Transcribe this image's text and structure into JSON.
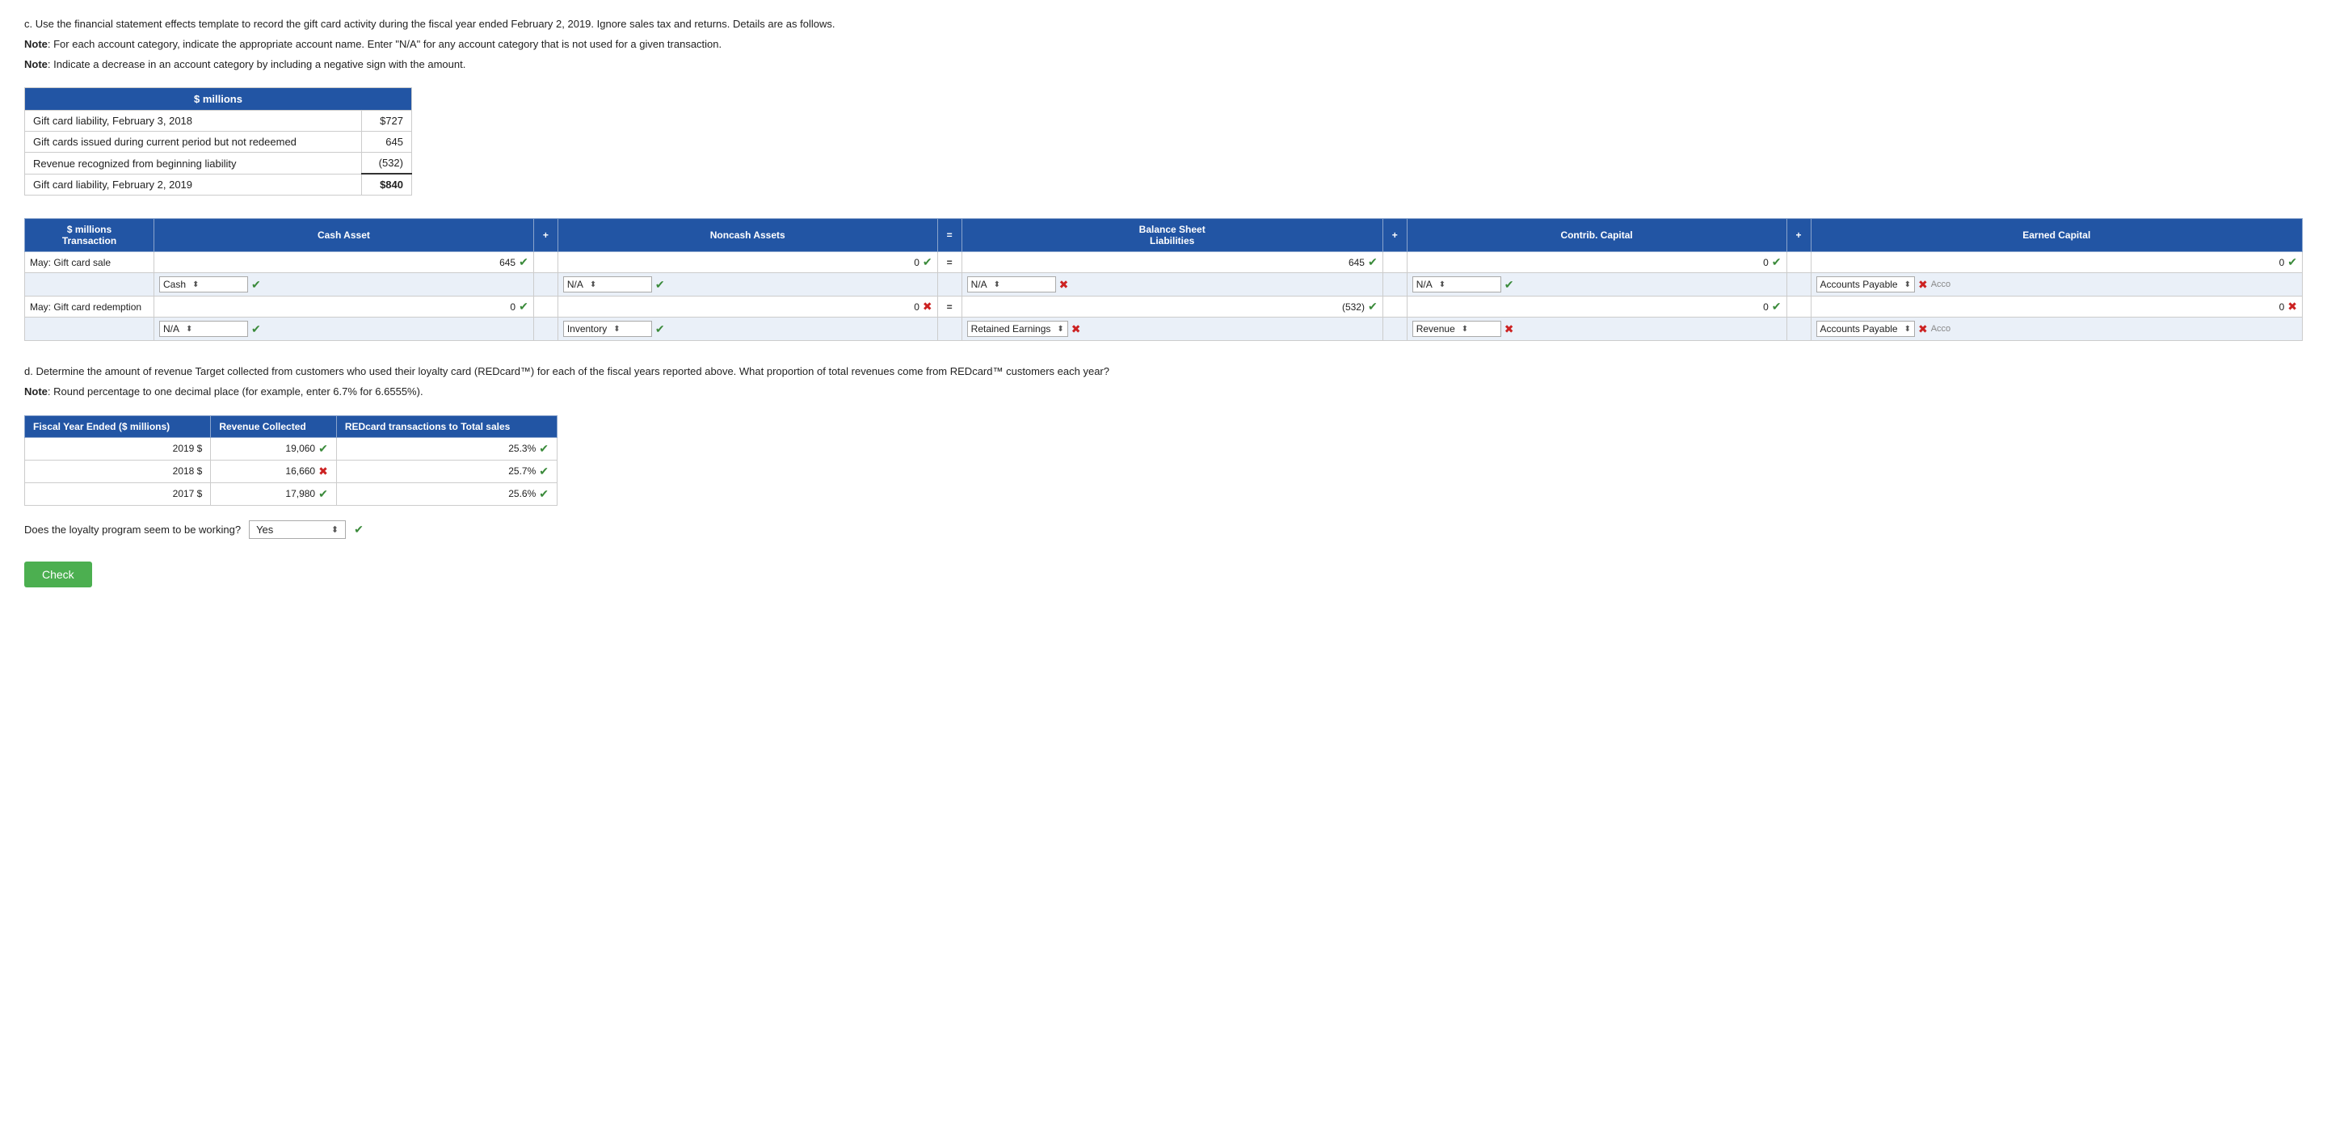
{
  "instructions": {
    "line1": "c. Use the financial statement effects template to record the gift card activity during the fiscal year ended February 2, 2019. Ignore sales tax and returns. Details are as follows.",
    "note1_prefix": "Note",
    "note1_text": ": For each account category, indicate the appropriate account name. Enter \"N/A\" for any account category that is not used for a given transaction.",
    "note2_prefix": "Note",
    "note2_text": ": Indicate a decrease in an account category by including a negative sign with the amount."
  },
  "gift_card_table": {
    "header": "$ millions",
    "rows": [
      {
        "label": "Gift card liability, February 3, 2018",
        "value": "$727"
      },
      {
        "label": "Gift cards issued during current period but not redeemed",
        "value": "645"
      },
      {
        "label": "Revenue recognized from beginning liability",
        "value": "(532)"
      },
      {
        "label": "Gift card liability, February 2, 2019",
        "value": "$840"
      }
    ]
  },
  "balance_sheet": {
    "headers": {
      "col1": "$ millions\nTransaction",
      "col2": "Cash Asset",
      "col3": "+",
      "col4": "Noncash Assets",
      "col5": "=",
      "col6": "Balance Sheet\nLiabilities",
      "col7": "+",
      "col8": "Contrib. Capital",
      "col9": "+",
      "col10": "Earned Capital"
    },
    "rows": [
      {
        "type": "value",
        "transaction": "May: Gift card sale",
        "cash_val": "645",
        "cash_icon": "check",
        "noncash_val": "0",
        "noncash_icon": "check",
        "op_eq": "=",
        "liabilities_val": "645",
        "liabilities_icon": "check",
        "contrib_val": "0",
        "contrib_icon": "check",
        "earned_val": "0",
        "earned_icon": "check"
      },
      {
        "type": "account",
        "cash_account": "Cash",
        "cash_status": "check",
        "noncash_account": "N/A",
        "noncash_status": "check",
        "liabilities_account": "N/A",
        "liabilities_status": "cross",
        "contrib_account": "N/A",
        "contrib_status": "check",
        "earned_account": "Accounts Payable",
        "earned_status": "cross",
        "earned_partial": "Acco"
      },
      {
        "type": "value",
        "transaction": "May: Gift card redemption",
        "cash_val": "0",
        "cash_icon": "check",
        "noncash_val": "0",
        "noncash_icon": "cross",
        "op_eq": "=",
        "liabilities_val": "(532)",
        "liabilities_icon": "check",
        "contrib_val": "0",
        "contrib_icon": "check",
        "earned_val": "0",
        "earned_icon": "cross"
      },
      {
        "type": "account",
        "cash_account": "N/A",
        "cash_status": "check",
        "noncash_account": "Inventory",
        "noncash_status": "check",
        "liabilities_account": "Retained Earnings",
        "liabilities_status": "cross",
        "contrib_account": "Revenue",
        "contrib_status": "cross",
        "earned_account": "Accounts Payable",
        "earned_status": "cross",
        "earned_partial": "Acco"
      }
    ]
  },
  "section_d": {
    "text": "d. Determine the amount of revenue Target collected from customers who used their loyalty card (REDcard™) for each of the fiscal years reported above. What proportion of total revenues come from REDcard™ customers each year?",
    "note_prefix": "Note",
    "note_text": ": Round percentage to one decimal place (for example, enter 6.7% for 6.6555%)."
  },
  "fy_table": {
    "headers": {
      "col1": "Fiscal Year Ended ($ millions)",
      "col2": "Revenue Collected",
      "col3": "REDcard transactions to Total sales"
    },
    "rows": [
      {
        "year": "2019",
        "currency": "$",
        "revenue": "19,060",
        "rev_icon": "check",
        "pct": "25.3%",
        "pct_icon": "check"
      },
      {
        "year": "2018",
        "currency": "$",
        "revenue": "16,660",
        "rev_icon": "cross",
        "pct": "25.7%",
        "pct_icon": "check"
      },
      {
        "year": "2017",
        "currency": "$",
        "revenue": "17,980",
        "rev_icon": "check",
        "pct": "25.6%",
        "pct_icon": "check"
      }
    ]
  },
  "loyalty_question": {
    "label": "Does the loyalty program seem to be working?",
    "answer": "Yes",
    "icon": "check"
  },
  "check_button": {
    "label": "Check"
  }
}
